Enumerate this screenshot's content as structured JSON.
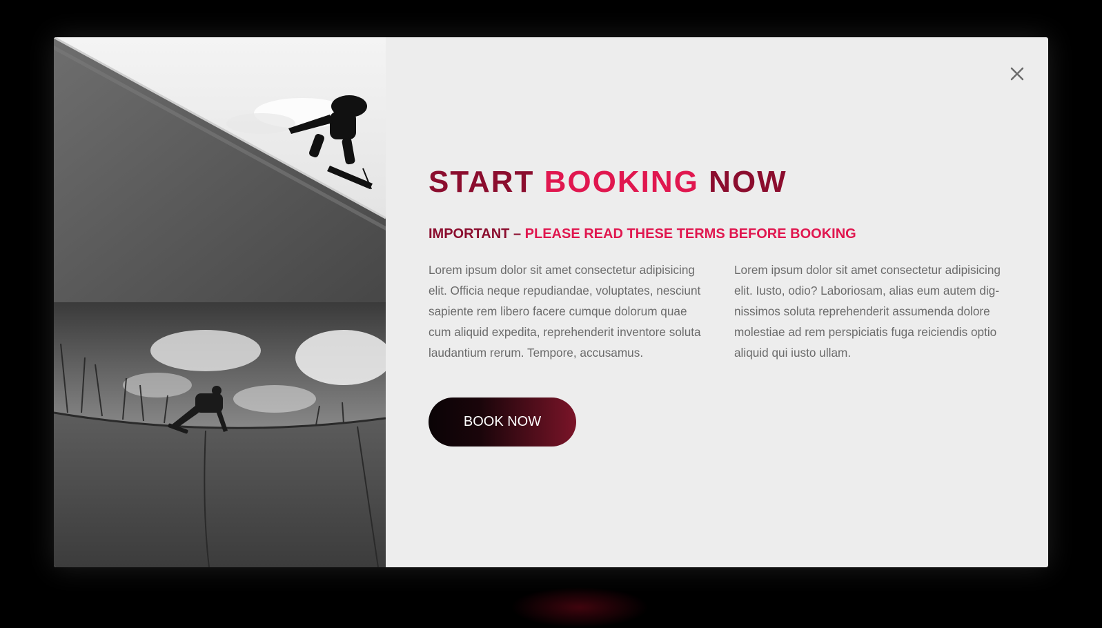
{
  "modal": {
    "close_icon": "close-icon",
    "heading": {
      "word1": "START",
      "word2": "BOOKING",
      "word3": "NOW"
    },
    "subheading": {
      "part1": "IMPORTANT – ",
      "part2": "PLEASE READ THESE TERMS BEFORE BOOKING"
    },
    "paragraph_left": "Lorem ipsum dolor sit amet consectetur adipisicing elit. Officia neque repudiandae, voluptates, nesci­unt sapiente rem libero facere cumque dolorum quae cum aliquid expedita, reprehenderit inventore soluta laudantium rerum. Tempore, accusamus.",
    "paragraph_right": "Lorem ipsum dolor sit amet consectetur adipisicing elit. Iusto, odio? Laboriosam, alias eum autem dig­nissimos soluta reprehenderit assumenda dolore molestiae ad rem perspiciatis fuga reiciendis optio aliquid qui iusto ullam.",
    "book_button_label": "BOOK NOW"
  },
  "colors": {
    "backdrop": "#000000",
    "modal_bg": "#ededed",
    "heading_dark": "#8b0d2e",
    "heading_accent": "#e0174f",
    "body_text": "#6b6b6b",
    "button_gradient_start": "#0a0406",
    "button_gradient_end": "#7a1428"
  },
  "images": [
    {
      "name": "skater-jumping-ramp-photo",
      "style": "black-and-white"
    },
    {
      "name": "skater-grinding-bowl-photo",
      "style": "black-and-white"
    }
  ]
}
